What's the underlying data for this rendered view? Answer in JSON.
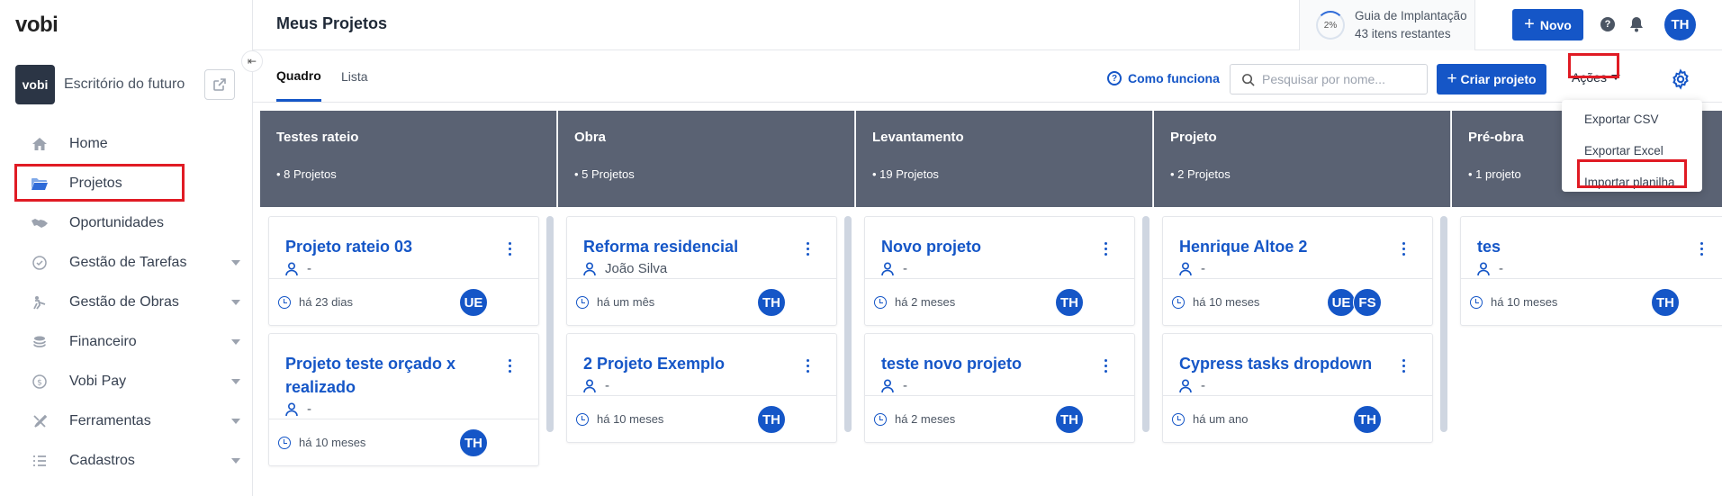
{
  "app": {
    "logo": "vobi"
  },
  "workspace": {
    "avatar_text": "vobi",
    "name": "Escritório do futuro"
  },
  "sidebar": {
    "items": [
      {
        "label": "Home",
        "icon": "home-icon",
        "has_caret": false
      },
      {
        "label": "Projetos",
        "icon": "folder-icon",
        "has_caret": false,
        "active": true
      },
      {
        "label": "Oportunidades",
        "icon": "handshake-icon",
        "has_caret": false
      },
      {
        "label": "Gestão de Tarefas",
        "icon": "tasks-icon",
        "has_caret": true
      },
      {
        "label": "Gestão de Obras",
        "icon": "worker-icon",
        "has_caret": true
      },
      {
        "label": "Financeiro",
        "icon": "coins-icon",
        "has_caret": true
      },
      {
        "label": "Vobi Pay",
        "icon": "dollar-icon",
        "has_caret": true
      },
      {
        "label": "Ferramentas",
        "icon": "tools-icon",
        "has_caret": true
      },
      {
        "label": "Cadastros",
        "icon": "list-icon",
        "has_caret": true
      }
    ]
  },
  "header": {
    "title": "Meus Projetos",
    "guide": {
      "percent": "2%",
      "title": "Guia de Implantação",
      "remaining": "43 itens restantes"
    },
    "new_button": "Novo",
    "user_initials": "TH"
  },
  "toolbar": {
    "tabs": [
      "Quadro",
      "Lista"
    ],
    "how_it_works": "Como funciona",
    "search_placeholder": "Pesquisar por nome...",
    "create_button": "Criar projeto",
    "actions_label": "Ações"
  },
  "actions_menu": {
    "items": [
      "Exportar CSV",
      "Exportar Excel",
      "Importar planilha"
    ]
  },
  "board": {
    "columns": [
      {
        "title": "Testes rateio",
        "count": "• 8 Projetos",
        "cards": [
          {
            "title": "Projeto rateio 03",
            "owner": "-",
            "time": "há 23 dias",
            "avatars": [
              "UE"
            ]
          },
          {
            "title": "Projeto teste orçado x realizado",
            "owner": "-",
            "time": "há 10 meses",
            "avatars": [
              "TH"
            ]
          }
        ]
      },
      {
        "title": "Obra",
        "count": "• 5 Projetos",
        "cards": [
          {
            "title": "Reforma residencial",
            "owner": "João Silva",
            "time": "há um mês",
            "avatars": [
              "TH"
            ]
          },
          {
            "title": "2 Projeto Exemplo",
            "owner": "-",
            "time": "há 10 meses",
            "avatars": [
              "TH"
            ]
          }
        ]
      },
      {
        "title": "Levantamento",
        "count": "• 19 Projetos",
        "cards": [
          {
            "title": "Novo projeto",
            "owner": "-",
            "time": "há 2 meses",
            "avatars": [
              "TH"
            ]
          },
          {
            "title": "teste novo projeto",
            "owner": "-",
            "time": "há 2 meses",
            "avatars": [
              "TH"
            ]
          }
        ]
      },
      {
        "title": "Projeto",
        "count": "• 2 Projetos",
        "cards": [
          {
            "title": "Henrique Altoe 2",
            "owner": "-",
            "time": "há 10 meses",
            "avatars": [
              "UE",
              "FS"
            ]
          },
          {
            "title": "Cypress tasks dropdown",
            "owner": "-",
            "time": "há um ano",
            "avatars": [
              "TH"
            ]
          }
        ]
      },
      {
        "title": "Pré-obra",
        "count": "• 1 projeto",
        "cards": [
          {
            "title": "tes",
            "owner": "-",
            "time": "há 10 meses",
            "avatars": [
              "TH"
            ]
          }
        ]
      }
    ]
  },
  "colors": {
    "primary": "#1556c7",
    "column_header": "#5a6273",
    "highlight": "#e01b24"
  }
}
